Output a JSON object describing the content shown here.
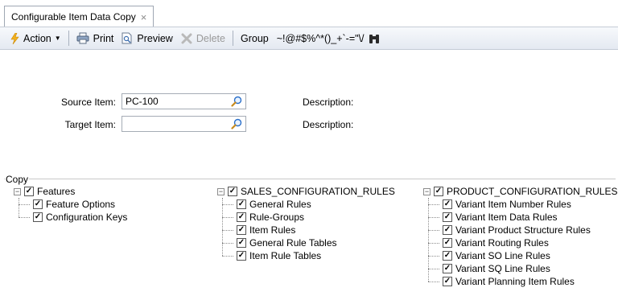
{
  "tab": {
    "title": "Configurable Item Data Copy",
    "close_glyph": "×"
  },
  "toolbar": {
    "action_label": "Action",
    "print_label": "Print",
    "preview_label": "Preview",
    "delete_label": "Delete",
    "group_label": "Group",
    "special_text": "~!@#$%^*()_+`-=\"\\/",
    "icons": [
      "lightning-icon",
      "printer-icon",
      "preview-icon",
      "delete-icon",
      "binoculars-icon"
    ]
  },
  "form": {
    "source_label": "Source Item:",
    "source_value": "PC-100",
    "source_desc_label": "Description:",
    "target_label": "Target Item:",
    "target_value": "",
    "target_desc_label": "Description:"
  },
  "copy": {
    "legend": "Copy",
    "features": {
      "label": "Features",
      "children": [
        "Feature Options",
        "Configuration Keys"
      ]
    },
    "sales": {
      "label": "SALES_CONFIGURATION_RULES",
      "children": [
        "General Rules",
        "Rule-Groups",
        "Item Rules",
        "General Rule Tables",
        "Item Rule Tables"
      ]
    },
    "product": {
      "label": "PRODUCT_CONFIGURATION_RULES",
      "children": [
        "Variant Item Number Rules",
        "Variant Item Data Rules",
        "Variant Product Structure Rules",
        "Variant Routing Rules",
        "Variant SO Line Rules",
        "Variant SQ Line Rules",
        "Variant Planning Item Rules"
      ]
    }
  },
  "colors": {
    "toolbar_top": "#f7f9fc",
    "toolbar_bottom": "#e4e9f1",
    "border": "#a5acb5",
    "lookup_blue": "#2a6fc9"
  }
}
